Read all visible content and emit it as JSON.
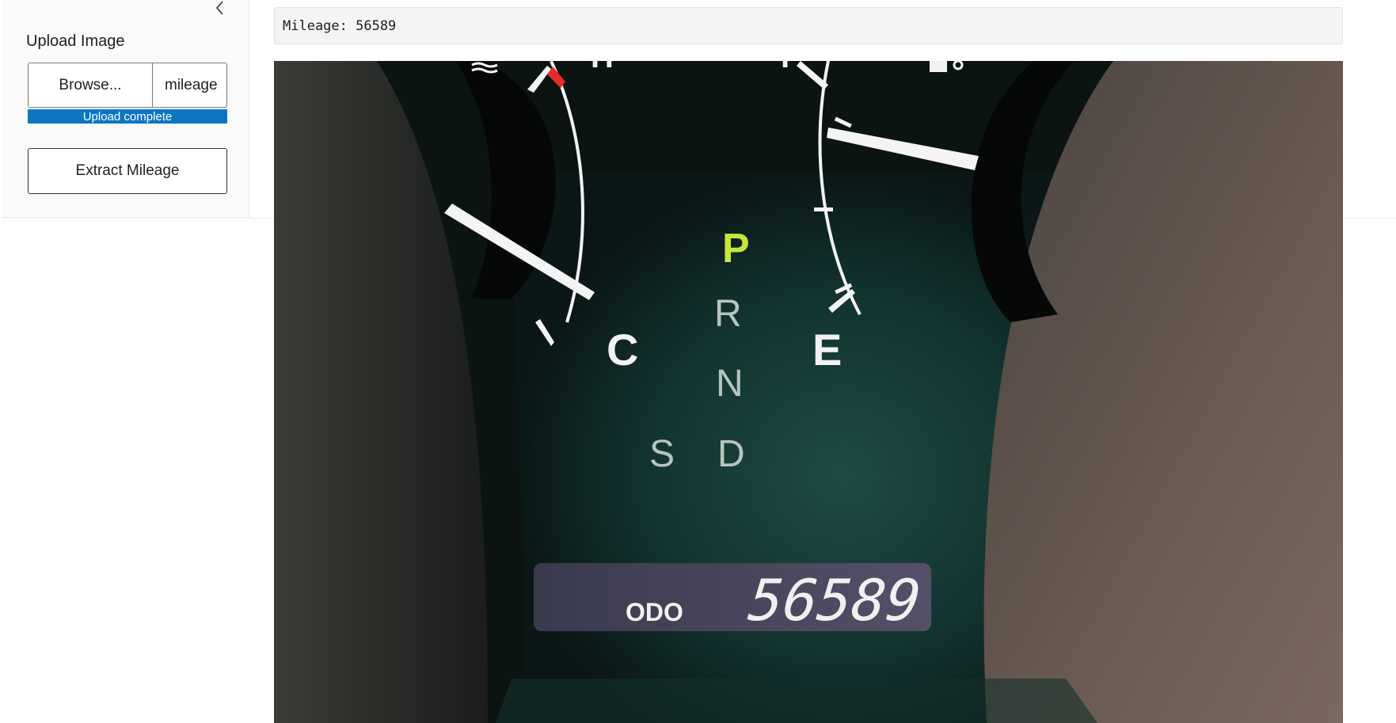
{
  "sidebar": {
    "upload_label": "Upload Image",
    "browse_label": "Browse...",
    "file_name": "mileage",
    "progress_text": "Upload complete",
    "progress": 1.0,
    "extract_label": "Extract Mileage",
    "collapse_icon": "chevron-left-icon"
  },
  "main": {
    "result_text": "Mileage: 56589",
    "photo": {
      "gear_p": "P",
      "gear_r": "R",
      "gear_n": "N",
      "gear_s": "S",
      "gear_d": "D",
      "temp_c": "C",
      "temp_h": "H",
      "fuel_e": "E",
      "fuel_f": "F",
      "odo_label": "ODO",
      "odo_value": "56589"
    }
  },
  "colors": {
    "accent": "#0a76c4",
    "sidebar_bg": "#fafafa",
    "result_bg": "#f4f4f4"
  }
}
